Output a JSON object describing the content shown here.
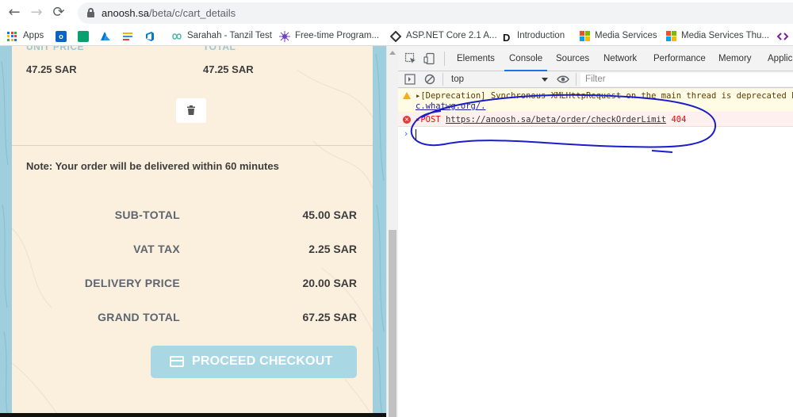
{
  "browser": {
    "url_host": "anoosh.sa",
    "url_path": "/beta/c/cart_details",
    "bookmarks": [
      {
        "label": "Apps"
      },
      {
        "label": ""
      },
      {
        "label": ""
      },
      {
        "label": ""
      },
      {
        "label": ""
      },
      {
        "label": ""
      },
      {
        "label": "Sarahah - Tanzil Test"
      },
      {
        "label": "Free-time Program..."
      },
      {
        "label": "ASP.NET Core 2.1 A..."
      },
      {
        "label": "Introduction"
      },
      {
        "label": "Media Services"
      },
      {
        "label": "Media Services Thu..."
      }
    ]
  },
  "cart": {
    "price_header_cut": "UNIT PRICE",
    "total_header_cut": "TOTAL",
    "unit_price": "47.25 SAR",
    "total": "47.25 SAR",
    "note": "Note: Your order will be delivered within 60 minutes",
    "summary": [
      {
        "label": "SUB-TOTAL",
        "value": "45.00 SAR"
      },
      {
        "label": "VAT TAX",
        "value": "2.25 SAR"
      },
      {
        "label": "DELIVERY PRICE",
        "value": "20.00 SAR"
      },
      {
        "label": "GRAND TOTAL",
        "value": "67.25 SAR"
      }
    ],
    "checkout_label": "PROCEED CHECKOUT"
  },
  "devtools": {
    "tabs": [
      "Elements",
      "Console",
      "Sources",
      "Network",
      "Performance",
      "Memory",
      "Applic"
    ],
    "active_tab": "Console",
    "context": "top",
    "filter_placeholder": "Filter",
    "warning_text": "[Deprecation] Synchronous XMLHttpRequest on the main thread is deprecated bec",
    "warning_link": "c.whatwg.org/.",
    "error_method": "POST",
    "error_url": "https://anoosh.sa/beta/order/checkOrderLimit",
    "error_code": "404"
  },
  "colors": {
    "accent": "#a9d8e4",
    "card_bg": "#fbefde",
    "error": "#e53935",
    "annotation": "#1c1cc9"
  }
}
